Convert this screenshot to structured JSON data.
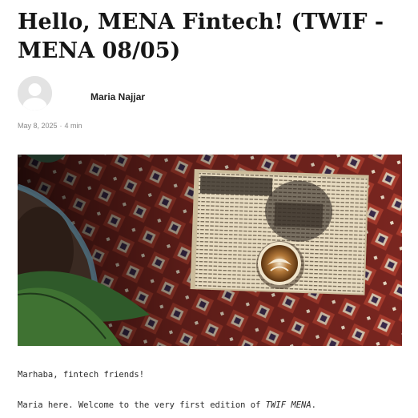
{
  "article": {
    "title": "Hello, MENA Fintech! (TWIF - MENA 08/05)",
    "author": "Maria Najjar",
    "date": "May 8, 2025",
    "separator": "·",
    "read_time": "4 min",
    "body": {
      "p1": "Marhaba, fintech friends!",
      "p2_prefix": "Maria here. Welcome to the very first edition of ",
      "p2_emphasis": "TWIF MENA",
      "p2_suffix": "."
    }
  },
  "icons": {
    "avatar": "user-silhouette-icon"
  },
  "colors": {
    "title": "#161616",
    "meta": "#8a8a8a",
    "rug_red": "#8e2a22",
    "newspaper": "#e8dcc0"
  }
}
